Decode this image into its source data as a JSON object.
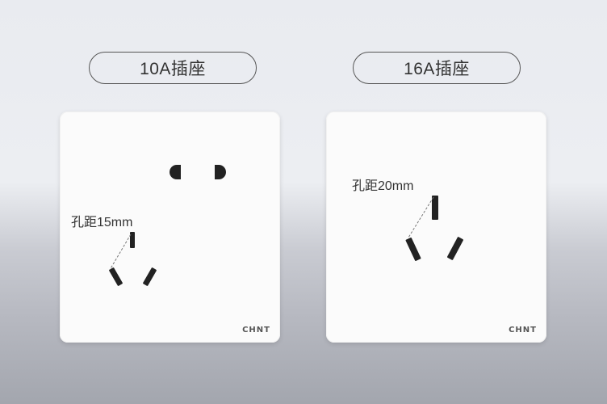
{
  "left": {
    "title": "10A插座",
    "distance_label": "孔距15mm",
    "brand": "CHNT"
  },
  "right": {
    "title": "16A插座",
    "distance_label": "孔距20mm",
    "brand": "CHNT"
  },
  "colors": {
    "background_top": "#e9ebf0",
    "background_bottom": "#a3a6ae",
    "panel": "#fbfbfb",
    "socket_hole": "#222222"
  }
}
